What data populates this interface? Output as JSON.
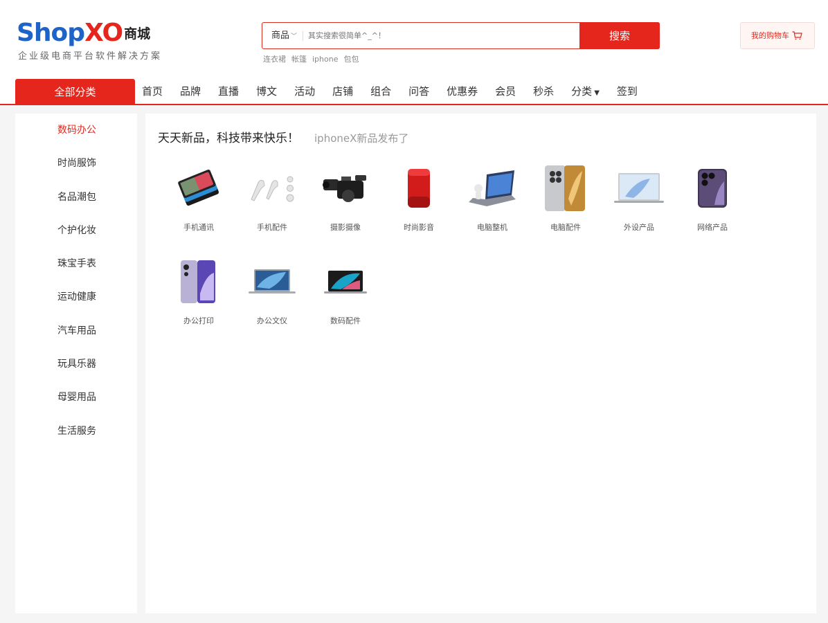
{
  "logo": {
    "brand_part1": "Shop",
    "brand_part2": "XO",
    "brand_suffix": "商城",
    "tagline": "企业级电商平台软件解决方案"
  },
  "search": {
    "category": "商品",
    "placeholder": "其实搜索很简单^_^！",
    "button": "搜索",
    "hot_words": [
      "连衣裙",
      "帐篷",
      "iphone",
      "包包"
    ]
  },
  "cart": {
    "label": "我的购物车",
    "icon": "cart-icon"
  },
  "nav": {
    "all_categories": "全部分类",
    "items": [
      "首页",
      "品牌",
      "直播",
      "博文",
      "活动",
      "店铺",
      "组合",
      "问答",
      "优惠券",
      "会员",
      "秒杀",
      "分类",
      "签到"
    ]
  },
  "sidebar": {
    "items": [
      "数码办公",
      "时尚服饰",
      "名品潮包",
      "个护化妆",
      "珠宝手表",
      "运动健康",
      "汽车用品",
      "玩具乐器",
      "母婴用品",
      "生活服务"
    ],
    "active_index": 0
  },
  "main": {
    "headline": "天天新品，科技带来快乐！",
    "sub_headline": "iphoneX新品发布了",
    "categories": [
      {
        "label": "手机通讯",
        "icon": "phones-icon"
      },
      {
        "label": "手机配件",
        "icon": "earbuds-icon"
      },
      {
        "label": "摄影摄像",
        "icon": "camcorder-icon"
      },
      {
        "label": "时尚影音",
        "icon": "speaker-icon"
      },
      {
        "label": "电脑整机",
        "icon": "laptop-icon"
      },
      {
        "label": "电脑配件",
        "icon": "phone-back-icon"
      },
      {
        "label": "外设产品",
        "icon": "laptop-silver-icon"
      },
      {
        "label": "网络产品",
        "icon": "iphone-icon"
      },
      {
        "label": "办公打印",
        "icon": "phone-purple-icon"
      },
      {
        "label": "办公文仪",
        "icon": "laptop-blue-icon"
      },
      {
        "label": "数码配件",
        "icon": "macbook-icon"
      }
    ]
  },
  "colors": {
    "accent": "#e5261c",
    "logo_blue": "#1e63c8"
  }
}
